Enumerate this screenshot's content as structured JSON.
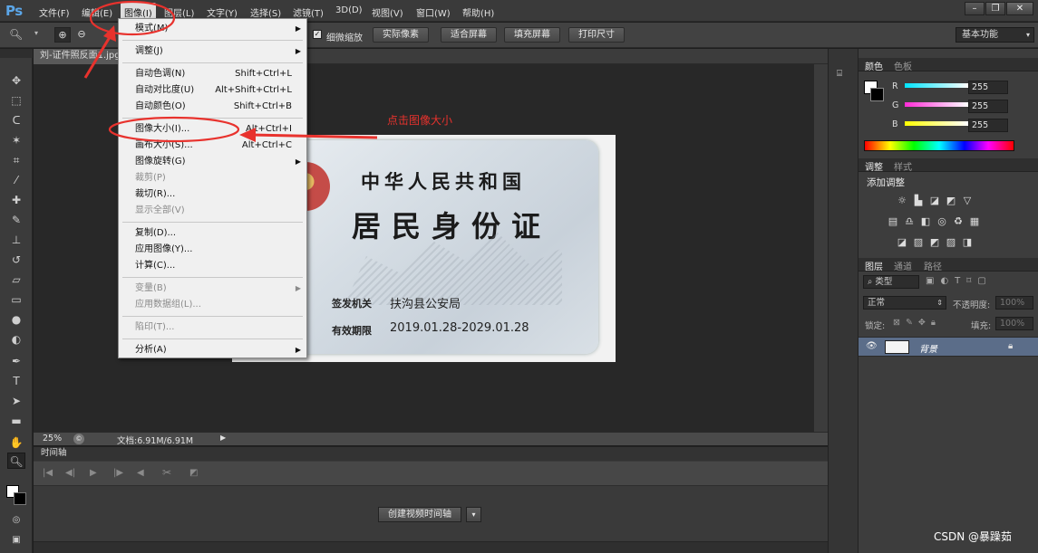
{
  "app": {
    "logo": "Ps"
  },
  "menubar": {
    "items": [
      "文件(F)",
      "编辑(E)",
      "图像(I)",
      "图层(L)",
      "文字(Y)",
      "选择(S)",
      "滤镜(T)",
      "3D(D)",
      "视图(V)",
      "窗口(W)",
      "帮助(H)"
    ],
    "active": "图像(I)"
  },
  "window_controls": {
    "minimize": "–",
    "restore": "❐",
    "close": "✕"
  },
  "options_bar": {
    "checkbox_label": "细微缩放",
    "buttons": [
      "实际像素",
      "适合屏幕",
      "填充屏幕",
      "打印尺寸"
    ],
    "workspace": "基本功能"
  },
  "document": {
    "tab_title": "刘-证件照反面1.jpg",
    "zoom": "25%",
    "doc_info": "文档:6.91M/6.91M"
  },
  "image_menu": {
    "items": [
      {
        "label": "模式(M)",
        "shortcut": "",
        "submenu": true,
        "disabled": false
      },
      {
        "sep": true
      },
      {
        "label": "调整(J)",
        "shortcut": "",
        "submenu": true,
        "disabled": false
      },
      {
        "sep": true
      },
      {
        "label": "自动色调(N)",
        "shortcut": "Shift+Ctrl+L",
        "submenu": false,
        "disabled": false
      },
      {
        "label": "自动对比度(U)",
        "shortcut": "Alt+Shift+Ctrl+L",
        "submenu": false,
        "disabled": false
      },
      {
        "label": "自动颜色(O)",
        "shortcut": "Shift+Ctrl+B",
        "submenu": false,
        "disabled": false
      },
      {
        "sep": true
      },
      {
        "label": "图像大小(I)...",
        "shortcut": "Alt+Ctrl+I",
        "submenu": false,
        "disabled": false
      },
      {
        "label": "画布大小(S)...",
        "shortcut": "Alt+Ctrl+C",
        "submenu": false,
        "disabled": false
      },
      {
        "label": "图像旋转(G)",
        "shortcut": "",
        "submenu": true,
        "disabled": false
      },
      {
        "label": "裁剪(P)",
        "shortcut": "",
        "submenu": false,
        "disabled": true
      },
      {
        "label": "裁切(R)...",
        "shortcut": "",
        "submenu": false,
        "disabled": false
      },
      {
        "label": "显示全部(V)",
        "shortcut": "",
        "submenu": false,
        "disabled": true
      },
      {
        "sep": true
      },
      {
        "label": "复制(D)...",
        "shortcut": "",
        "submenu": false,
        "disabled": false
      },
      {
        "label": "应用图像(Y)...",
        "shortcut": "",
        "submenu": false,
        "disabled": false
      },
      {
        "label": "计算(C)...",
        "shortcut": "",
        "submenu": false,
        "disabled": false
      },
      {
        "sep": true
      },
      {
        "label": "变量(B)",
        "shortcut": "",
        "submenu": true,
        "disabled": true
      },
      {
        "label": "应用数据组(L)...",
        "shortcut": "",
        "submenu": false,
        "disabled": true
      },
      {
        "sep": true
      },
      {
        "label": "陷印(T)...",
        "shortcut": "",
        "submenu": false,
        "disabled": true
      },
      {
        "sep": true
      },
      {
        "label": "分析(A)",
        "shortcut": "",
        "submenu": true,
        "disabled": false
      }
    ]
  },
  "annotation": {
    "text": "点击图像大小",
    "color": "#e8322d"
  },
  "id_card": {
    "line1": "中华人民共和国",
    "line2": "居民身份证",
    "authority_label": "签发机关",
    "authority_value": "扶沟县公安局",
    "validity_label": "有效期限",
    "validity_value": "2019.01.28-2029.01.28"
  },
  "timeline": {
    "tab": "时间轴",
    "create_button": "创建视频时间轴"
  },
  "color_panel": {
    "tabs": [
      "颜色",
      "色板"
    ],
    "channels": [
      {
        "name": "R",
        "value": "255",
        "color": "#00e5ff"
      },
      {
        "name": "G",
        "value": "255",
        "color": "#ff2bd6"
      },
      {
        "name": "B",
        "value": "255",
        "color": "#ffff00"
      }
    ]
  },
  "adjust_panel": {
    "tabs": [
      "调整",
      "样式"
    ],
    "title": "添加调整"
  },
  "layers_panel": {
    "tabs": [
      "图层",
      "通道",
      "路径"
    ],
    "filter": "类型",
    "blend_mode": "正常",
    "opacity_label": "不透明度:",
    "opacity_value": "100%",
    "lock_label": "锁定:",
    "fill_label": "填充:",
    "fill_value": "100%",
    "layer_name": "背景"
  },
  "watermark": "CSDN @暴躁茹"
}
